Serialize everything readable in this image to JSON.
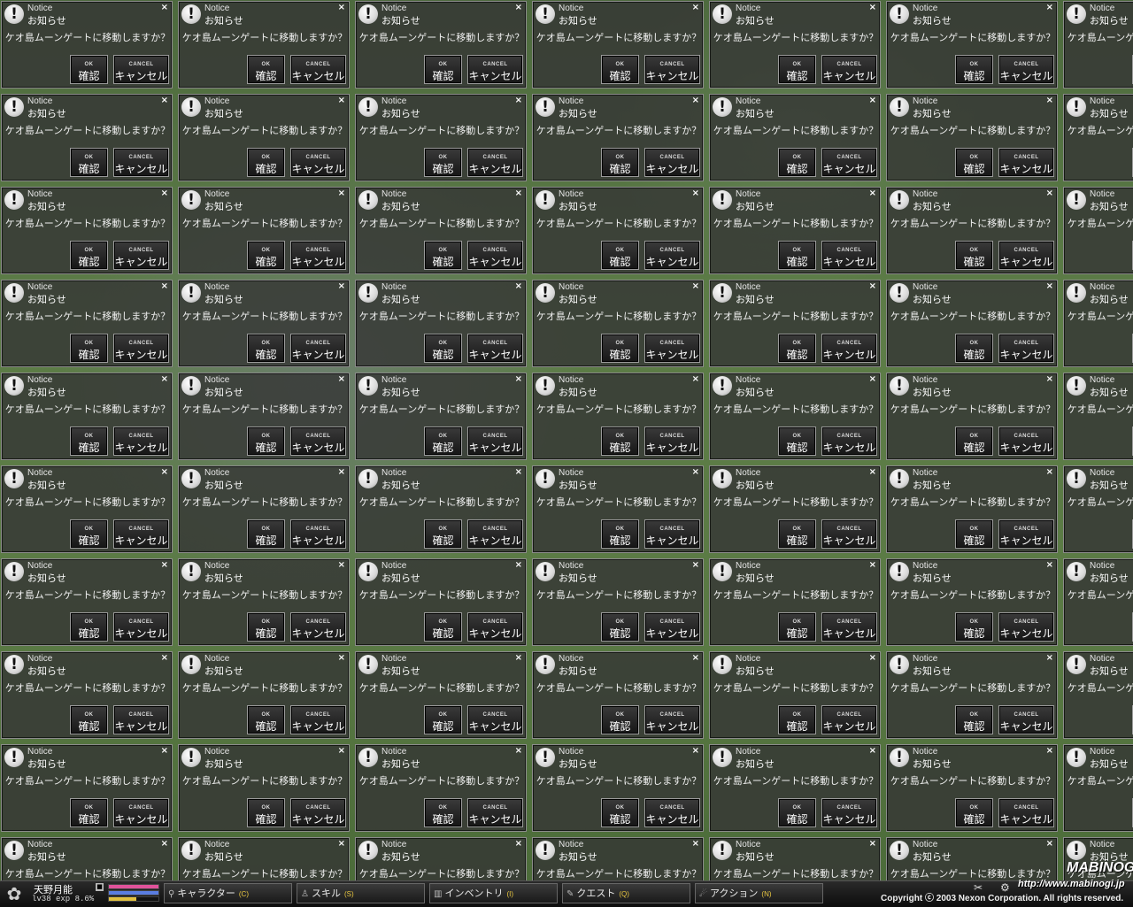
{
  "dialog": {
    "icon": "exclamation-icon",
    "icon_glyph": "!",
    "title_en": "Notice",
    "title_jp": "お知らせ",
    "message": "ケオ島ムーンゲートに移動しますか？",
    "close_glyph": "×",
    "ok_en": "OK",
    "ok_jp": "確認",
    "cancel_en": "CANCEL",
    "cancel_jp": "キャンセル",
    "rows": 10,
    "columns": 7
  },
  "status": {
    "character_name": "天野月能",
    "level_line": "lv38 exp 8.6%",
    "bars": [
      {
        "name": "hp",
        "fraction": 1.0,
        "color": "#e0529a"
      },
      {
        "name": "mp",
        "fraction": 1.0,
        "color": "#5a7de0"
      },
      {
        "name": "stamina",
        "fraction": 0.55,
        "color": "#e0c040"
      }
    ],
    "toggle_glyph": "■"
  },
  "menu": [
    {
      "icon": "magnifier-icon",
      "glyph": "⚲",
      "label": "キャラクター",
      "key": "(C)"
    },
    {
      "icon": "skill-icon",
      "glyph": "♙",
      "label": "スキル",
      "key": "(S)"
    },
    {
      "icon": "bag-icon",
      "glyph": "▥",
      "label": "インベントリ",
      "key": "(I)"
    },
    {
      "icon": "quest-icon",
      "glyph": "✎",
      "label": "クエスト",
      "key": "(Q)"
    },
    {
      "icon": "action-icon",
      "glyph": "☄",
      "label": "アクション",
      "key": "(N)"
    }
  ],
  "branding": {
    "logo": "MABINOGI",
    "url": "http://www.mabinogi.jp",
    "copyright": "Copyright ⓒ 2003 Nexon Corporation. All rights reserved."
  },
  "colors": {
    "accent_key": "#e8c640",
    "dialog_bg": "#343434"
  }
}
